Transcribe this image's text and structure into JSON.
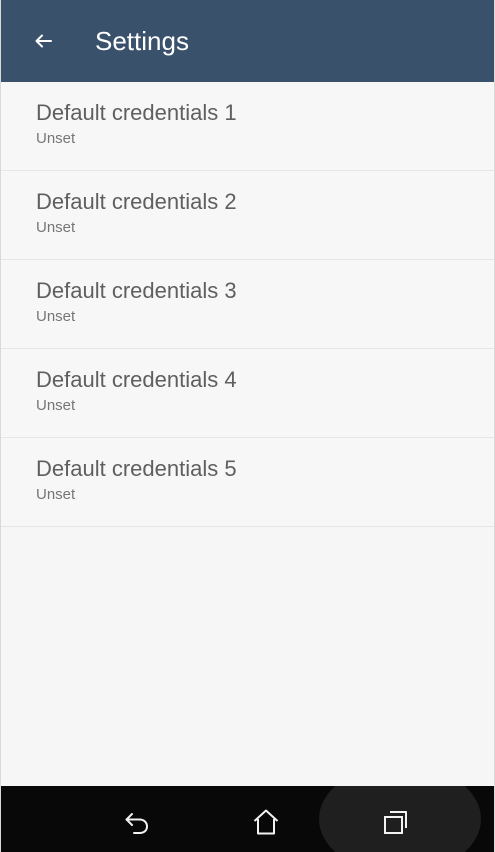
{
  "app_bar": {
    "title": "Settings",
    "back_icon": "arrow-left-icon"
  },
  "settings": {
    "items": [
      {
        "title": "Default credentials 1",
        "summary": "Unset"
      },
      {
        "title": "Default credentials 2",
        "summary": "Unset"
      },
      {
        "title": "Default credentials 3",
        "summary": "Unset"
      },
      {
        "title": "Default credentials 4",
        "summary": "Unset"
      },
      {
        "title": "Default credentials 5",
        "summary": "Unset"
      }
    ]
  },
  "navigation": {
    "back_icon": "undo-arrow-icon",
    "home_icon": "home-outline-icon",
    "recents_icon": "recent-apps-icon"
  },
  "colors": {
    "app_bar": "#3a516c",
    "background": "#f6f6f6",
    "primary_text": "#5f5f5f",
    "secondary_text": "#767676",
    "divider": "#e6e6e6",
    "nav_bar": "#080808"
  }
}
